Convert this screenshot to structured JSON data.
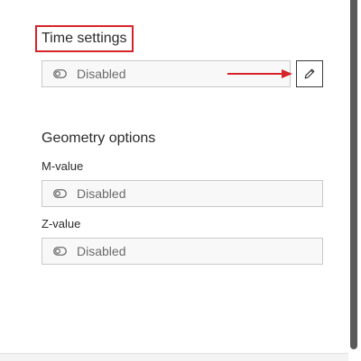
{
  "time_settings": {
    "title": "Time settings",
    "field": {
      "value": "Disabled",
      "icon": "toggle-off-icon"
    },
    "edit_button": {
      "icon": "pencil-icon"
    }
  },
  "geometry_options": {
    "title": "Geometry options",
    "m_value": {
      "label": "M-value",
      "field": {
        "value": "Disabled",
        "icon": "toggle-off-icon"
      }
    },
    "z_value": {
      "label": "Z-value",
      "field": {
        "value": "Disabled",
        "icon": "toggle-off-icon"
      }
    }
  },
  "colors": {
    "annotation_red": "#d6232a",
    "field_border": "#c9c9c9",
    "field_background": "#f8f8f8",
    "text": "#2b2b2b",
    "muted_text": "#6b6b6b",
    "scrollbar": "#5a5a5a"
  }
}
